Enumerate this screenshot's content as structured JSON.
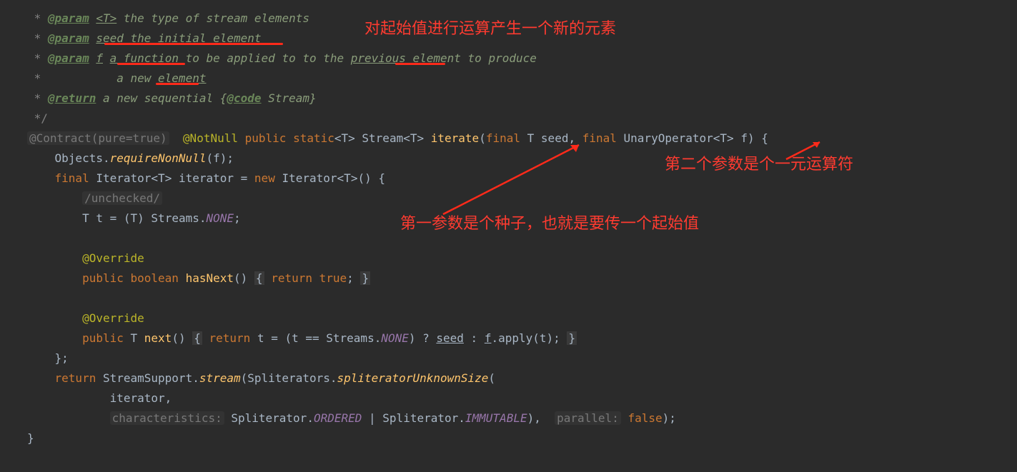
{
  "doc": {
    "l1": {
      "tag": "@param",
      "p": "<T>",
      "txt": " the type of stream elements"
    },
    "l2": {
      "tag": "@param",
      "p": "seed",
      "txt": " the initial element"
    },
    "l3": {
      "tag": "@param",
      "p": "f",
      "fn": "a function",
      "txt": " to be applied to to the ",
      "prev": "previou",
      "txt2": "s element to produce"
    },
    "l4": {
      "txt": "a new ",
      "el": "element"
    },
    "l5": {
      "tag": "@return",
      "txt": " a new sequential {",
      "code": "@code",
      "txt2": " Stream}"
    }
  },
  "sig": {
    "contract": "@Contract(pure=true)",
    "notnull": "@NotNull",
    "public": "public",
    "static": "static",
    "stream": "Stream",
    "iterate": "iterate",
    "final": "final",
    "T": "T",
    "seed": "seed",
    "unary": "UnaryOperator",
    "f": "f"
  },
  "b": {
    "objreq": "Objects.",
    "req": "requireNonNull",
    "f": "(f);",
    "finalIter": "final",
    "Iterator": "Iterator",
    "ident": "iterator",
    "neww": "new",
    "unchecked": "/unchecked/",
    "T": "T",
    "t": "t",
    "eq": " = (",
    "cast": "T",
    "streams": ") Streams.",
    "none": "NONE",
    "semi": ";",
    "ov": "@Override",
    "pub": "public",
    "bool": "boolean",
    "hasnext": "hasNext",
    "rettrue": "return",
    "true": "true",
    "next": "next",
    "rett": "return",
    "teq": "t = (t == Streams.",
    "none2": "NONE",
    "q": ") ? ",
    "seed": "seed",
    "colon": " : ",
    "fu": "f",
    "apply": ".apply(t);",
    "ret": "return",
    "ss": "StreamSupport.",
    "stream": "stream",
    "spl": "(Spliterators.",
    "sus": "spliteratorUnknownSize",
    "open": "(",
    "iter": "iterator,",
    "char": "characteristics:",
    "splc": " Spliterator.",
    "ord": "ORDERED",
    "pipe": " | Spliterator.",
    "imm": "IMMUTABLE",
    "close": "),  ",
    "par": "parallel:",
    "false": " false",
    "end": ");"
  },
  "notes": {
    "top": "对起始值进行运算产生一个新的元素",
    "right": "第二个参数是个一元运算符",
    "mid": "第一参数是个种子，也就是要传一个起始值"
  }
}
